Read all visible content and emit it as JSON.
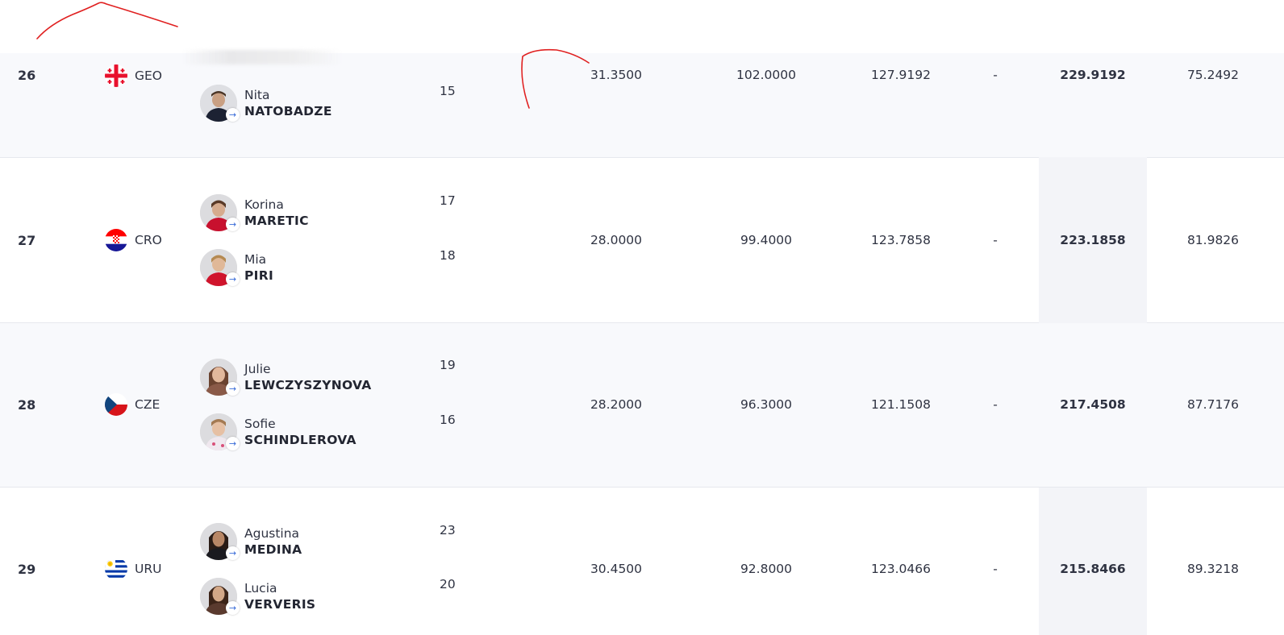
{
  "rows": [
    {
      "rank": "26",
      "noc": "GEO",
      "flag": "geo-flag",
      "athletes": [
        {
          "first": "Nita",
          "last": "NATOBADZE",
          "bib": "15"
        }
      ],
      "scores": [
        "31.3500",
        "102.0000",
        "127.9192",
        "-",
        "229.9192",
        "75.2492"
      ]
    },
    {
      "rank": "27",
      "noc": "CRO",
      "flag": "cro-flag",
      "athletes": [
        {
          "first": "Korina",
          "last": "MARETIC",
          "bib": "17"
        },
        {
          "first": "Mia",
          "last": "PIRI",
          "bib": "18"
        }
      ],
      "scores": [
        "28.0000",
        "99.4000",
        "123.7858",
        "-",
        "223.1858",
        "81.9826"
      ]
    },
    {
      "rank": "28",
      "noc": "CZE",
      "flag": "cze-flag",
      "athletes": [
        {
          "first": "Julie",
          "last": "LEWCZYSZYNOVA",
          "bib": "19"
        },
        {
          "first": "Sofie",
          "last": "SCHINDLEROVA",
          "bib": "16"
        }
      ],
      "scores": [
        "28.2000",
        "96.3000",
        "121.1508",
        "-",
        "217.4508",
        "87.7176"
      ]
    },
    {
      "rank": "29",
      "noc": "URU",
      "flag": "uru-flag",
      "athletes": [
        {
          "first": "Agustina",
          "last": "MEDINA",
          "bib": "23"
        },
        {
          "first": "Lucia",
          "last": "VERVERIS",
          "bib": "20"
        }
      ],
      "scores": [
        "30.4500",
        "92.8000",
        "123.0466",
        "-",
        "215.8466",
        "89.3218"
      ]
    }
  ],
  "colors": {
    "accent": "#3a6cd8",
    "row_alt": "#f8f9fc",
    "total_col": "#f3f4f8",
    "annotation": "#e02020"
  }
}
